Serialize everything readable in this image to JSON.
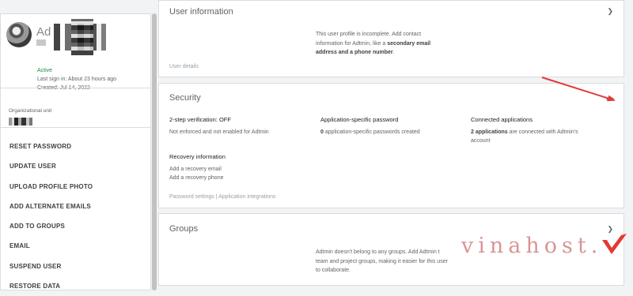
{
  "profile": {
    "name": "Ad",
    "status": "Active",
    "last_sign_in": "Last sign in: About 23 hours ago",
    "created": "Created: Jul 14, 2022"
  },
  "org": {
    "label": "Organizational unit"
  },
  "actions": [
    "RESET PASSWORD",
    "UPDATE USER",
    "UPLOAD PROFILE PHOTO",
    "ADD ALTERNATE EMAILS",
    "ADD TO GROUPS",
    "EMAIL",
    "SUSPEND USER",
    "RESTORE DATA"
  ],
  "user_info": {
    "title": "User information",
    "message_line1": "This user profile is incomplete. Add contact",
    "message_line2_plain": "information for Adtmin, like a ",
    "message_line2_bold": "secondary email",
    "message_line3_bold": "address and a phone number",
    "message_line3_end": ".",
    "footer_link": "User details"
  },
  "security": {
    "title": "Security",
    "two_step_head": "2-step verification: OFF",
    "two_step_body": "Not enforced and not enabled for Adtmin",
    "app_pw_head": "Application-specific password",
    "app_pw_count": "0",
    "app_pw_body": " application-specific passwords created",
    "connected_head": "Connected applications",
    "connected_count": "2 applications",
    "connected_body_1": " are connected with Adtmin's",
    "connected_body_2": "account",
    "recovery_head": "Recovery information",
    "recovery_email": "Add a recovery email",
    "recovery_phone": "Add a recovery phone",
    "footer_links": "Password settings | Application integrations"
  },
  "groups": {
    "title": "Groups",
    "msg1": "Adtmin doesn't belong to any groups. Add Adtmin t",
    "msg2": "team and project groups, making it easier for this user",
    "msg3": "to collaborate."
  },
  "watermark": {
    "text": "vinahost."
  },
  "icons": {
    "chevron_down": "chevron-down-icon",
    "chevron_up": "chevron-up-icon"
  },
  "colors": {
    "active_green": "#1e8e3e",
    "annotation_red": "#e53935"
  }
}
